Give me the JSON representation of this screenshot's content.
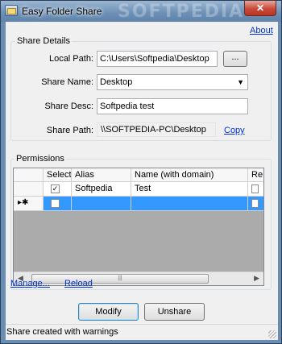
{
  "window": {
    "title": "Easy Folder Share",
    "watermark": "SOFTPEDIA",
    "close_glyph": "✕"
  },
  "about_link": "About",
  "share_details": {
    "group_title": "Share Details",
    "local_path_label": "Local Path:",
    "local_path_value": "C:\\Users\\Softpedia\\Desktop",
    "browse_label": "...",
    "share_name_label": "Share Name:",
    "share_name_value": "Desktop",
    "share_desc_label": "Share Desc:",
    "share_desc_value": "Softpedia test",
    "share_path_label": "Share Path:",
    "share_path_value": "\\\\SOFTPEDIA-PC\\Desktop",
    "copy_link": "Copy"
  },
  "permissions": {
    "group_title": "Permissions",
    "columns": [
      "Select",
      "Alias",
      "Name (with domain)",
      "Re"
    ],
    "rows": [
      {
        "selected": true,
        "alias": "Softpedia",
        "name": "Test"
      }
    ],
    "new_row_marker": "▸✱",
    "manage_link": "Manage...",
    "reload_link": "Reload"
  },
  "buttons": {
    "modify": "Modify",
    "unshare": "Unshare"
  },
  "status": {
    "text": "Share created with warnings"
  }
}
